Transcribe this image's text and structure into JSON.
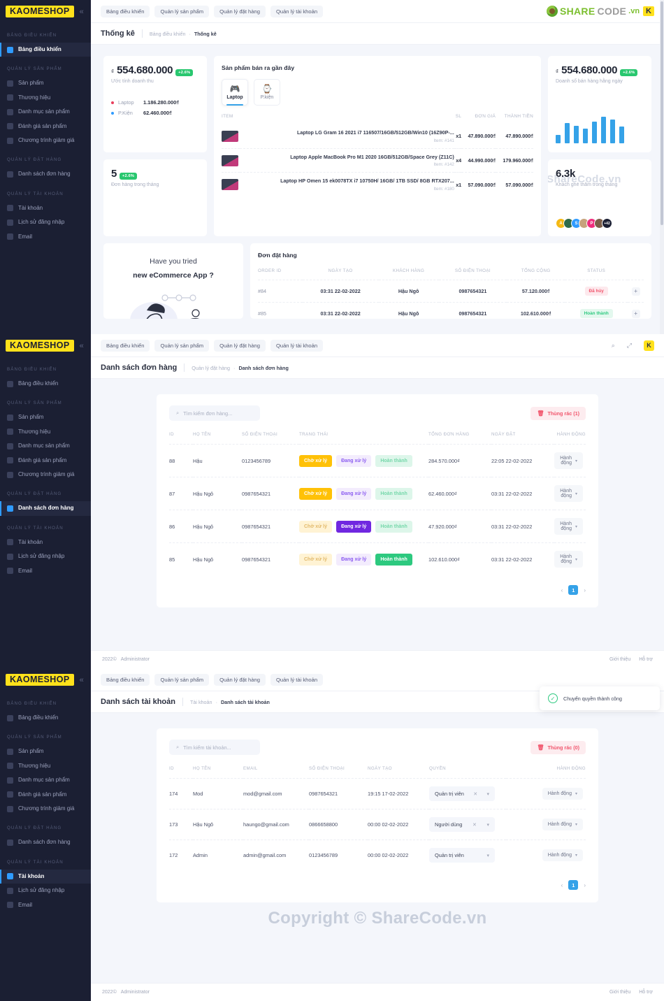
{
  "brand": {
    "name": "KAOMESHOP",
    "collapse_icon": "chevrons-left-icon"
  },
  "sidebar": {
    "groups": [
      {
        "label": "BẢNG ĐIỀU KHIỂN",
        "items": [
          {
            "label": "Bảng điều khiển",
            "icon": "dashboard-icon"
          }
        ]
      },
      {
        "label": "QUẢN LÝ SẢN PHẨM",
        "items": [
          {
            "label": "Sản phẩm",
            "icon": "box-icon"
          },
          {
            "label": "Thương hiệu",
            "icon": "shield-icon"
          },
          {
            "label": "Danh mục sản phẩm",
            "icon": "list-icon"
          },
          {
            "label": "Đánh giá sản phẩm",
            "icon": "pencil-icon"
          },
          {
            "label": "Chương trình giảm giá",
            "icon": "tag-icon"
          }
        ]
      },
      {
        "label": "QUẢN LÝ ĐẶT HÀNG",
        "items": [
          {
            "label": "Danh sách đơn hàng",
            "icon": "cart-icon"
          }
        ]
      },
      {
        "label": "QUẢN LÝ TÀI KHOẢN",
        "items": [
          {
            "label": "Tài khoản",
            "icon": "user-icon"
          },
          {
            "label": "Lịch sử đăng nhập",
            "icon": "flag-icon"
          },
          {
            "label": "Email",
            "icon": "mail-icon"
          }
        ]
      }
    ]
  },
  "topbar": {
    "tabs": [
      "Bảng điều khiển",
      "Quản lý sản phẩm",
      "Quản lý đặt hàng",
      "Quản lý tài khoản"
    ],
    "search_icon": "search-icon",
    "fullscreen_icon": "expand-icon",
    "avatar_letter": "K"
  },
  "sharecode_logo": {
    "part1": "SHARE",
    "part2": "CODE",
    "part3": ".vn",
    "badge": "K"
  },
  "watermarks": {
    "small": "ShareCode.vn",
    "big": "Copyright © ShareCode.vn"
  },
  "dashboard": {
    "page_title": "Thống kê",
    "breadcrumb": [
      "Bảng điều khiển",
      "Thống kê"
    ],
    "revenue_card": {
      "currency": "₫",
      "value": "554.680.000",
      "badge": "+2.6%",
      "sub": "Ước tính doanh thu",
      "legend": [
        {
          "name": "Laptop",
          "value": "1.186.280.000₫",
          "color": "#e83e5c"
        },
        {
          "name": "P.Kiện",
          "value": "62.460.000₫",
          "color": "#2f9bff"
        }
      ]
    },
    "orders_month_card": {
      "value": "5",
      "badge": "+2.6%",
      "sub": "Đơn hàng trong tháng"
    },
    "daily_card": {
      "currency": "₫",
      "value": "554.680.000",
      "badge": "+2.6%",
      "sub": "Doanh số bán hàng hằng ngày"
    },
    "visitors_card": {
      "value": "6.3k",
      "sub": "Khách ghé thăm trong tháng",
      "avatars": [
        {
          "letter": "A",
          "color": "#f5b914"
        },
        {
          "letter": "",
          "color": "#2f6b4a"
        },
        {
          "letter": "S",
          "color": "#2f9bff"
        },
        {
          "letter": "",
          "color": "#c7a27c"
        },
        {
          "letter": "P",
          "color": "#ef2e7e"
        },
        {
          "letter": "",
          "color": "#7d5f4a"
        },
        {
          "letter": "+42",
          "color": "#1b1f33"
        }
      ]
    },
    "recent_products": {
      "title": "Sản phẩm bán ra gần đây",
      "tabs": [
        {
          "label": "Laptop",
          "icon": "laptop-icon",
          "emoji": "🎮",
          "active": true
        },
        {
          "label": "P.kiện",
          "icon": "watch-icon",
          "emoji": "⌚",
          "active": false
        }
      ],
      "columns": [
        "Item",
        "SL",
        "Đơn giá",
        "Thành tiền"
      ],
      "rows": [
        {
          "name": "Laptop LG Gram 16 2021 i7 116507/16GB/512GB/Win10 (16Z90P-...",
          "item": "Item: #141",
          "qty": "x1",
          "price": "47.890.000₫",
          "total": "47.890.000₫"
        },
        {
          "name": "Laptop Apple MacBook Pro M1 2020 16GB/512GB/Space Grey (Z11C)",
          "item": "Item: #142",
          "qty": "x4",
          "price": "44.990.000₫",
          "total": "179.960.000₫"
        },
        {
          "name": "Laptop HP Omen 15 ek0078TX i7 10750H/ 16GB/ 1TB SSD/ 8GB RTX207...",
          "item": "Item: #180",
          "qty": "x1",
          "price": "57.090.000₫",
          "total": "57.090.000₫"
        }
      ]
    },
    "promo": {
      "line1": "Have you tried",
      "line2": "new eCommerce App ?"
    },
    "orders_card": {
      "title": "Đơn đặt hàng",
      "columns": [
        "ORDER ID",
        "NGÀY TẠO",
        "KHÁCH HÀNG",
        "SỐ ĐIỆN THOẠI",
        "TỔNG CỘNG",
        "STATUS"
      ],
      "rows": [
        {
          "id": "#84",
          "date": "03:31 22-02-2022",
          "customer": "Hậu Ngô",
          "phone": "0987654321",
          "total": "57.120.000₫",
          "status": "Đã hủy",
          "status_kind": "red",
          "expand": "+"
        },
        {
          "id": "#85",
          "date": "03:31 22-02-2022",
          "customer": "Hậu Ngô",
          "phone": "0987654321",
          "total": "102.610.000₫",
          "status": "Hoàn thành",
          "status_kind": "green",
          "expand": "+"
        }
      ]
    }
  },
  "chart_data": {
    "type": "bar",
    "title": "Doanh số bán hàng hằng ngày",
    "categories": [
      "1",
      "2",
      "3",
      "4",
      "5",
      "6",
      "7",
      "8"
    ],
    "values": [
      22,
      52,
      46,
      38,
      56,
      70,
      62,
      44
    ],
    "ylim": [
      0,
      80
    ],
    "xlabel": "",
    "ylabel": "",
    "color": "#35a2e8",
    "grid": false,
    "legend": "none"
  },
  "orders_page": {
    "page_title": "Danh sách đơn hàng",
    "breadcrumb": [
      "Quản lý đặt hàng",
      "Danh sách đơn hàng"
    ],
    "search_placeholder": "Tìm kiếm đơn hàng...",
    "trash_label": "Thùng rác (1)",
    "columns": [
      "ID",
      "HỌ TÊN",
      "SỐ ĐIỆN THOẠI",
      "TRẠNG THÁI",
      "TỔNG ĐƠN HÀNG",
      "NGÀY ĐẶT",
      "HÀNH ĐỘNG"
    ],
    "status_labels": {
      "wait": "Chờ xử lý",
      "processing": "Đang xử lý",
      "done": "Hoàn thành"
    },
    "action_label": "Hành động",
    "rows": [
      {
        "id": "88",
        "name": "Hậu",
        "phone": "0123456789",
        "active": "wait",
        "total": "284.570.000₫",
        "date": "22:05 22-02-2022"
      },
      {
        "id": "87",
        "name": "Hậu Ngô",
        "phone": "0987654321",
        "active": "wait",
        "total": "62.460.000₫",
        "date": "03:31 22-02-2022"
      },
      {
        "id": "86",
        "name": "Hậu Ngô",
        "phone": "0987654321",
        "active": "processing",
        "total": "47.920.000₫",
        "date": "03:31 22-02-2022"
      },
      {
        "id": "85",
        "name": "Hậu Ngô",
        "phone": "0987654321",
        "active": "done",
        "total": "102.610.000₫",
        "date": "03:31 22-02-2022"
      }
    ],
    "pagination": {
      "prev": "‹",
      "page": "1",
      "next": "›"
    }
  },
  "accounts_page": {
    "page_title": "Danh sách tài khoản",
    "breadcrumb": [
      "Tài khoản",
      "Danh sách tài khoản"
    ],
    "search_placeholder": "Tìm kiếm tài khoản...",
    "trash_label": "Thùng rác (0)",
    "columns": [
      "ID",
      "HỌ TÊN",
      "EMAIL",
      "SỐ ĐIỆN THOẠI",
      "NGÀY TẠO",
      "QUYỀN",
      "HÀNH ĐỘNG"
    ],
    "action_label": "Hành động",
    "rows": [
      {
        "id": "174",
        "name": "Mod",
        "email": "mod@gmail.com",
        "phone": "0987654321",
        "created": "19:15 17-02-2022",
        "role": "Quản trị viên",
        "clearable": true,
        "id_link": false
      },
      {
        "id": "173",
        "name": "Hậu Ngô",
        "email": "haungo@gmail.com",
        "phone": "0866658800",
        "created": "00:00 02-02-2022",
        "role": "Người dùng",
        "clearable": true,
        "id_link": false
      },
      {
        "id": "172",
        "name": "Admin",
        "email": "admin@gmail.com",
        "phone": "0123456789",
        "created": "00:00 02-02-2022",
        "role": "Quản trị viên",
        "clearable": false,
        "id_link": true
      }
    ],
    "pagination": {
      "prev": "‹",
      "page": "1",
      "next": "›"
    }
  },
  "toast": {
    "icon": "check-circle-icon",
    "message": "Chuyển quyền thành công"
  },
  "footer": {
    "copyright": "2022©",
    "owner": "Administrator",
    "links": [
      "Giới thiệu",
      "Hỗ trợ"
    ]
  }
}
